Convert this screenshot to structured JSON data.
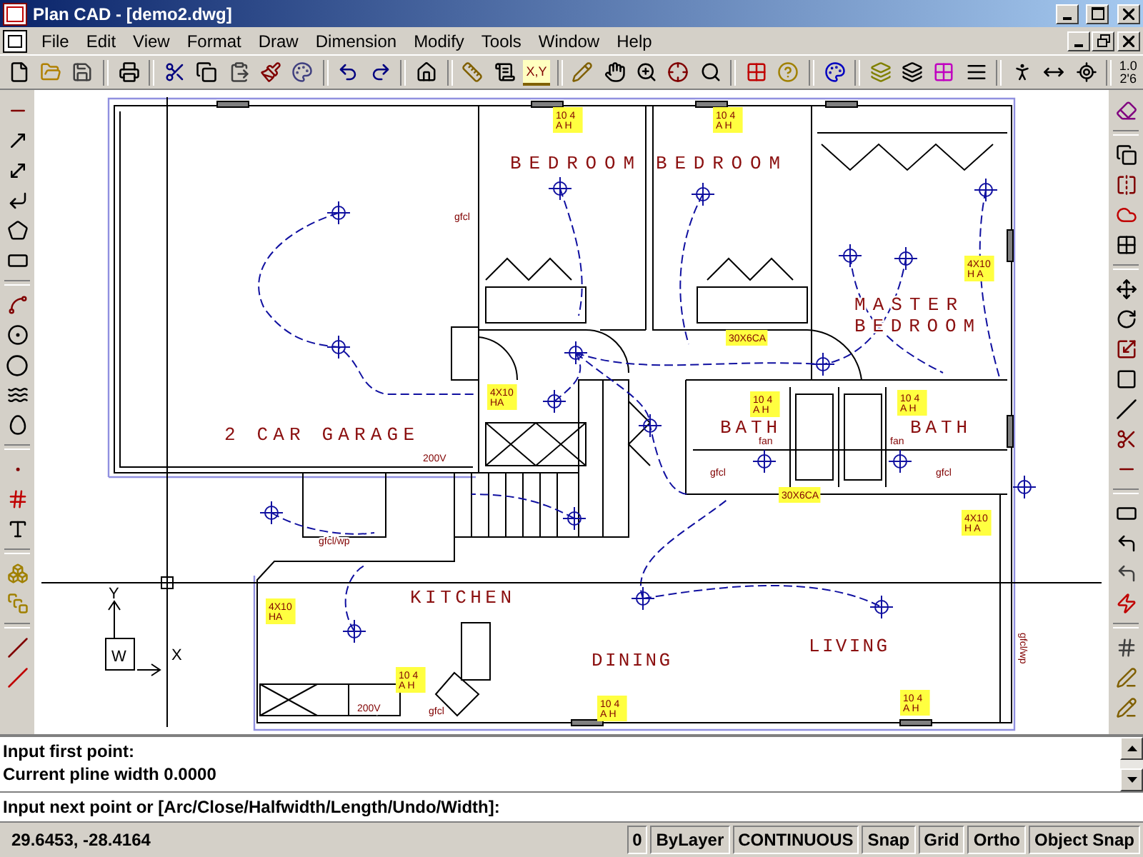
{
  "window": {
    "title": "Plan CAD - [demo2.dwg]"
  },
  "menu": [
    {
      "label": "File"
    },
    {
      "label": "Edit"
    },
    {
      "label": "View"
    },
    {
      "label": "Format"
    },
    {
      "label": "Draw"
    },
    {
      "label": "Dimension"
    },
    {
      "label": "Modify"
    },
    {
      "label": "Tools"
    },
    {
      "label": "Window"
    },
    {
      "label": "Help"
    }
  ],
  "toolbar": {
    "coordinate_icon_text": "X,Y",
    "scale_icon_lines": [
      "1.0",
      "2'6"
    ]
  },
  "drawing": {
    "rooms": [
      {
        "lines": [
          "BEDROOM"
        ]
      },
      {
        "lines": [
          "BEDROOM"
        ]
      },
      {
        "lines": [
          "MASTER",
          "BEDROOM"
        ]
      },
      {
        "lines": [
          "2 CAR GARAGE"
        ]
      },
      {
        "lines": [
          "BATH"
        ]
      },
      {
        "lines": [
          "BATH"
        ]
      },
      {
        "lines": [
          "KITCHEN"
        ]
      },
      {
        "lines": [
          "DINING"
        ]
      },
      {
        "lines": [
          "LIVING"
        ]
      }
    ],
    "annotations": [
      {
        "kind": "rating",
        "lines": [
          "10 4",
          "A H"
        ]
      },
      {
        "kind": "rating",
        "lines": [
          "10 4",
          "A H"
        ]
      },
      {
        "kind": "note",
        "lines": [
          "gfcl"
        ]
      },
      {
        "kind": "rating",
        "lines": [
          "4X10",
          "HA"
        ]
      },
      {
        "kind": "rating",
        "lines": [
          "4X10",
          "H A"
        ]
      },
      {
        "kind": "rating",
        "lines": [
          "30X6CA"
        ]
      },
      {
        "kind": "note",
        "lines": [
          "200V"
        ]
      },
      {
        "kind": "rating",
        "lines": [
          "10 4",
          "A H"
        ]
      },
      {
        "kind": "rating",
        "lines": [
          "10 4",
          "A H"
        ]
      },
      {
        "kind": "note",
        "lines": [
          "fan"
        ]
      },
      {
        "kind": "note",
        "lines": [
          "fan"
        ]
      },
      {
        "kind": "note",
        "lines": [
          "gfcl"
        ]
      },
      {
        "kind": "note",
        "lines": [
          "gfcl"
        ]
      },
      {
        "kind": "rating",
        "lines": [
          "30X6CA"
        ]
      },
      {
        "kind": "rating",
        "lines": [
          "4X10",
          "H A"
        ]
      },
      {
        "kind": "note",
        "lines": [
          "gfcl/wp"
        ]
      },
      {
        "kind": "rating",
        "lines": [
          "4X10",
          "HA"
        ]
      },
      {
        "kind": "rating",
        "lines": [
          "10 4",
          "A H"
        ]
      },
      {
        "kind": "rating",
        "lines": [
          "10 4",
          "A H"
        ]
      },
      {
        "kind": "rating",
        "lines": [
          "10 4",
          "A H"
        ]
      },
      {
        "kind": "note",
        "lines": [
          "200V"
        ]
      },
      {
        "kind": "note",
        "lines": [
          "gfcl"
        ]
      },
      {
        "kind": "vertical",
        "lines": [
          "gfcl/wp"
        ]
      }
    ],
    "ucs": {
      "y_label": "Y",
      "x_label": "X",
      "world_label": "W"
    }
  },
  "command": {
    "history": [
      "Input first point:",
      "Current pline width 0.0000"
    ],
    "value": "Input next point or [Arc/Close/Halfwidth/Length/Undo/Width]:"
  },
  "status_bar": {
    "coordinates": "29.6453, -28.4164",
    "panes": [
      {
        "label": "0"
      },
      {
        "label": "ByLayer"
      },
      {
        "label": "CONTINUOUS"
      },
      {
        "label": "Snap"
      },
      {
        "label": "Grid"
      },
      {
        "label": "Ortho"
      },
      {
        "label": "Object Snap"
      }
    ]
  }
}
